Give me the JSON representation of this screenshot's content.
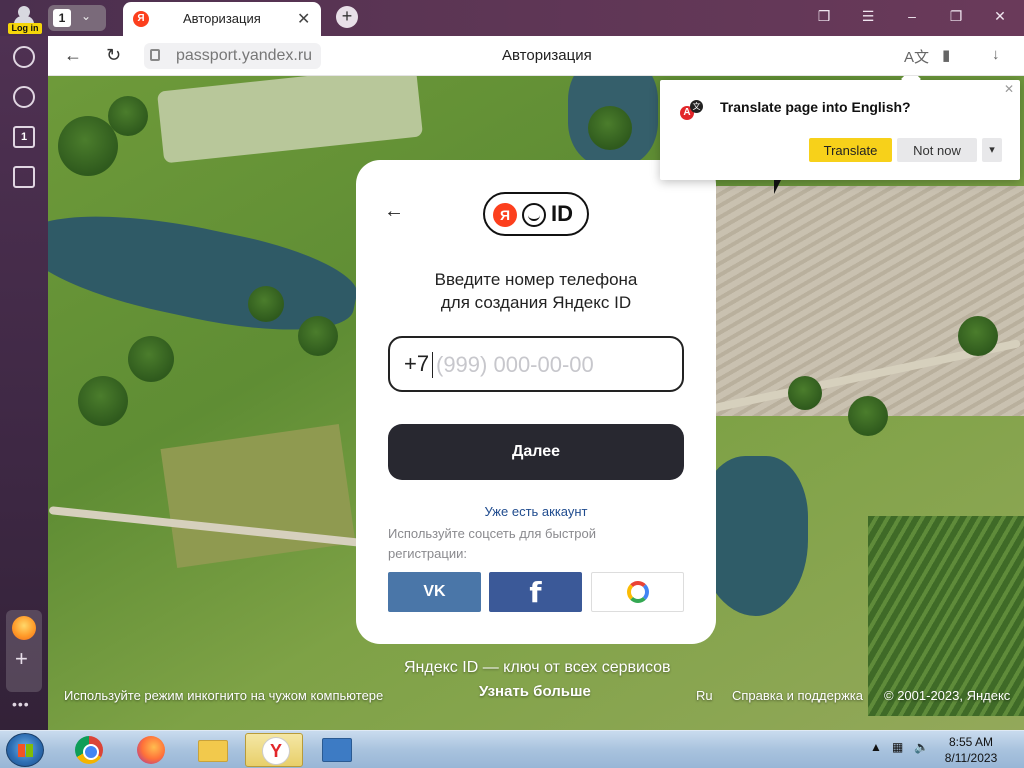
{
  "browser": {
    "login_badge": "Log in",
    "tab_group_count": "1",
    "tab": {
      "favicon_letter": "Я",
      "title": "Авторизация"
    },
    "address": {
      "url": "passport.yandex.ru",
      "page_title": "Авторизация"
    },
    "sidebar": {
      "tabs_count": "1",
      "more": "•••"
    }
  },
  "translate_popup": {
    "question": "Translate page into English?",
    "translate_label": "Translate",
    "not_now_label": "Not now",
    "badge_letters": {
      "a": "A",
      "b": "文"
    }
  },
  "login_card": {
    "logo": {
      "ya": "Я",
      "id": "ID"
    },
    "heading_line1": "Введите номер телефона",
    "heading_line2": "для создания Яндекс ID",
    "phone_prefix": "+7",
    "phone_placeholder": "(999) 000-00-00",
    "next_label": "Далее",
    "have_account_label": "Уже есть аккаунт",
    "social_hint": "Используйте соцсеть для быстрой регистрации:",
    "vk_label": "VK",
    "fb_label": "f"
  },
  "page_footer": {
    "slogan": "Яндекс ID — ключ от всех сервисов",
    "learn_more": "Узнать больше",
    "incognito_hint": "Используйте режим инкогнито на чужом компьютере",
    "lang": "Ru",
    "help": "Справка и поддержка",
    "copyright": "© 2001-2023, Яндекс"
  },
  "taskbar": {
    "time": "8:55 AM",
    "date": "8/11/2023",
    "yandex_letter": "Y"
  },
  "colors": {
    "brand_red": "#fc3f1d",
    "primary_button": "#282830",
    "translate_yellow": "#f7d11a",
    "vk_blue": "#4a76a8",
    "fb_blue": "#3b5998"
  }
}
